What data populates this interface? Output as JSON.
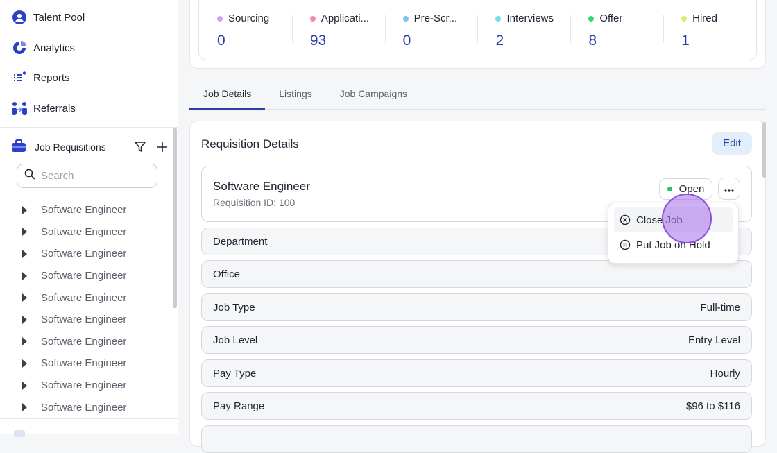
{
  "sidebar": {
    "nav": [
      {
        "label": "Talent Pool",
        "icon": "user-circle-icon"
      },
      {
        "label": "Analytics",
        "icon": "pie-chart-icon"
      },
      {
        "label": "Reports",
        "icon": "list-icon"
      },
      {
        "label": "Referrals",
        "icon": "people-icon"
      }
    ],
    "requisitions_title": "Job Requisitions",
    "search_placeholder": "Search",
    "requisitions": [
      "Software Engineer",
      "Software Engineer",
      "Software Engineer",
      "Software Engineer",
      "Software Engineer",
      "Software Engineer",
      "Software Engineer",
      "Software Engineer",
      "Software Engineer",
      "Software Engineer"
    ]
  },
  "pipeline": [
    {
      "label": "Sourcing",
      "value": "0",
      "color": "#c9a5f0"
    },
    {
      "label": "Applicati...",
      "value": "93",
      "color": "#f08bb8"
    },
    {
      "label": "Pre-Scr...",
      "value": "0",
      "color": "#7ec3ee"
    },
    {
      "label": "Interviews",
      "value": "2",
      "color": "#6ee0ea"
    },
    {
      "label": "Offer",
      "value": "8",
      "color": "#34d77a"
    },
    {
      "label": "Hired",
      "value": "1",
      "color": "#d4f07a"
    }
  ],
  "tabs": [
    "Job Details",
    "Listings",
    "Job Campaigns"
  ],
  "details": {
    "title": "Requisition Details",
    "edit_label": "Edit",
    "job_title": "Software Engineer",
    "requisition_id": "Requisition ID: 100",
    "status": "Open",
    "rows": [
      {
        "label": "Department",
        "value": ""
      },
      {
        "label": "Office",
        "value": ""
      },
      {
        "label": "Job Type",
        "value": "Full-time"
      },
      {
        "label": "Job Level",
        "value": "Entry Level"
      },
      {
        "label": "Pay Type",
        "value": "Hourly"
      },
      {
        "label": "Pay Range",
        "value": "$96 to $116"
      }
    ]
  },
  "menu": {
    "items": [
      {
        "label": "Close Job",
        "icon": "close-circle-icon"
      },
      {
        "label": "Put Job on Hold",
        "icon": "pause-circle-icon"
      }
    ]
  },
  "colors": {
    "accent": "#2a3ea8",
    "edit_bg": "#e3eefb",
    "status_open": "#22c55e"
  }
}
